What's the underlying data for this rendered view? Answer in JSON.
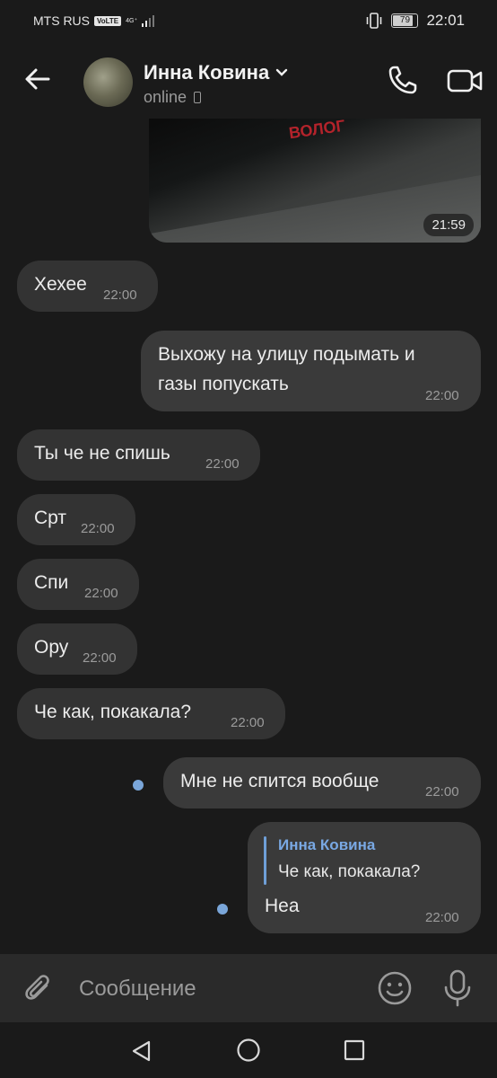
{
  "status_bar": {
    "carrier": "MTS RUS",
    "volte": "VoLTE",
    "network": "4G⁺",
    "battery": "79",
    "time": "22:01"
  },
  "header": {
    "contact_name": "Инна Ковина",
    "status": "online"
  },
  "messages": [
    {
      "type": "photo",
      "direction": "in",
      "time": "21:59"
    },
    {
      "direction": "in",
      "text": "Хехее",
      "time": "22:00"
    },
    {
      "direction": "out",
      "text_line1": "Выхожу на улицу подымать и",
      "text_line2": "газы попускать",
      "time": "22:00"
    },
    {
      "direction": "in",
      "text": "Ты че не спишь",
      "time": "22:00"
    },
    {
      "direction": "in",
      "text": "Срт",
      "time": "22:00"
    },
    {
      "direction": "in",
      "text": "Спи",
      "time": "22:00"
    },
    {
      "direction": "in",
      "text": "Ору",
      "time": "22:00"
    },
    {
      "direction": "in",
      "text": "Че как, покакала?",
      "time": "22:00"
    },
    {
      "direction": "out",
      "text": "Мне не спится вообще",
      "time": "22:00",
      "unread": true
    },
    {
      "direction": "out",
      "reply_to_name": "Инна Ковина",
      "reply_to_text": "Че как, покакала?",
      "text": "Неа",
      "time": "22:00",
      "unread": true
    }
  ],
  "input": {
    "placeholder": "Сообщение"
  },
  "colors": {
    "background": "#1a1a1a",
    "bubble_in": "#333333",
    "bubble_out": "#3a3a3a",
    "accent": "#79a8e3"
  }
}
